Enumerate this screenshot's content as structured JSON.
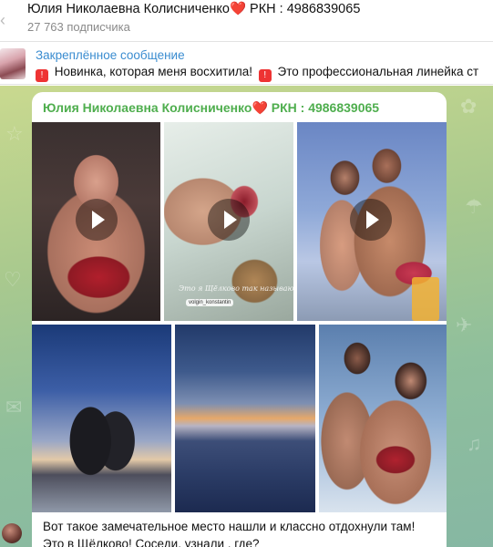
{
  "header": {
    "back_icon": "arrow-left-icon",
    "channel_title": "Юлия Николаевна Колисниченко",
    "heart_icon": "❤️",
    "channel_suffix": " РКН : 4986839065",
    "subscribers": "27 763 подписчика"
  },
  "pinned": {
    "label": "Закреплённое сообщение",
    "siren_icon": "🚨",
    "text_1": " Новинка, которая меня восхитила!",
    "text_2": " Это профессиональная линейка ст"
  },
  "message": {
    "author_name": "Юлия Николаевна Колисниченко",
    "author_heart": "❤️",
    "author_suffix": " РКН : 4986839065",
    "media": [
      {
        "kind": "video",
        "description": "woman-selfie-red-swimsuit"
      },
      {
        "kind": "video",
        "description": "hand-holding-jar",
        "watermark": "volgin_konstantin",
        "script_text": "Это я Щёлково так называю"
      },
      {
        "kind": "video",
        "description": "couple-at-sunset-pool"
      },
      {
        "kind": "photo",
        "description": "couple-silhouette-sunset"
      },
      {
        "kind": "photo",
        "description": "sunset-over-lake"
      },
      {
        "kind": "photo",
        "description": "couple-selfie-swimwear"
      }
    ],
    "caption_line_1": "Вот такое замечательное место нашли и классно отдохнули там!",
    "caption_line_2": "Это в Щёлково! Соседи, узнали , где?"
  },
  "colors": {
    "author_green": "#4fae4e",
    "pinned_blue": "#3a8cd0",
    "heart_red": "#e0252b"
  }
}
